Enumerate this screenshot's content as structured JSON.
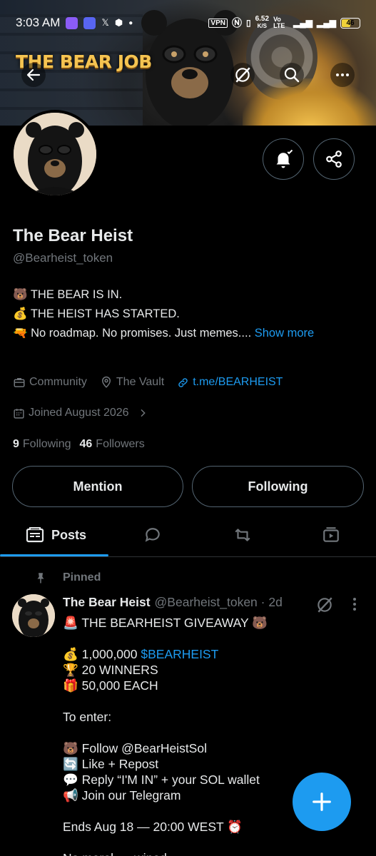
{
  "status_bar": {
    "time": "3:03 AM",
    "net_speed": "6.52",
    "net_unit": "K/S",
    "vo_lte": "Vo LTE",
    "battery": "46"
  },
  "banner": {
    "logo_text": "THE BEAR JOB"
  },
  "profile": {
    "name": "The Bear Heist",
    "handle": "@Bearheist_token",
    "bio": {
      "line1": "🐻 THE BEAR IS IN.",
      "line2": "💰 THE HEIST HAS STARTED.",
      "line3": "🔫 No roadmap. No promises. Just memes....",
      "show_more": "Show more"
    },
    "meta": {
      "category": "Community",
      "location": "The Vault",
      "website": "t.me/BEARHEIST",
      "joined": "Joined August 2026"
    },
    "following_count": "9",
    "following_label": "Following",
    "followers_count": "46",
    "followers_label": "Followers",
    "mention_button": "Mention",
    "following_button": "Following"
  },
  "tabs": {
    "posts": "Posts"
  },
  "post": {
    "pinned_label": "Pinned",
    "author": "The Bear Heist",
    "handle_time": "@Bearheist_token · 2d",
    "line1": "🚨 THE BEARHEIST GIVEAWAY 🐻",
    "line2_prefix": "💰 1,000,000 ",
    "line2_tag": "$BEARHEIST",
    "lines_a": "🏆 20 WINNERS\n🎁 50,000 EACH\n\nTo enter:\n\n🐻 Follow @BearHeistSol\n🔄 Like + Repost\n💬 Reply “I'M IN” + your SOL wallet\n📢 Join our Telegram\n\nEnds Aug 18 — 20:00 WEST ⏰\n\nNo marel, ... wined"
  },
  "colors": {
    "accent": "#1d9bf0",
    "muted": "#71767b",
    "text": "#e7e9ea",
    "border": "#536471"
  }
}
